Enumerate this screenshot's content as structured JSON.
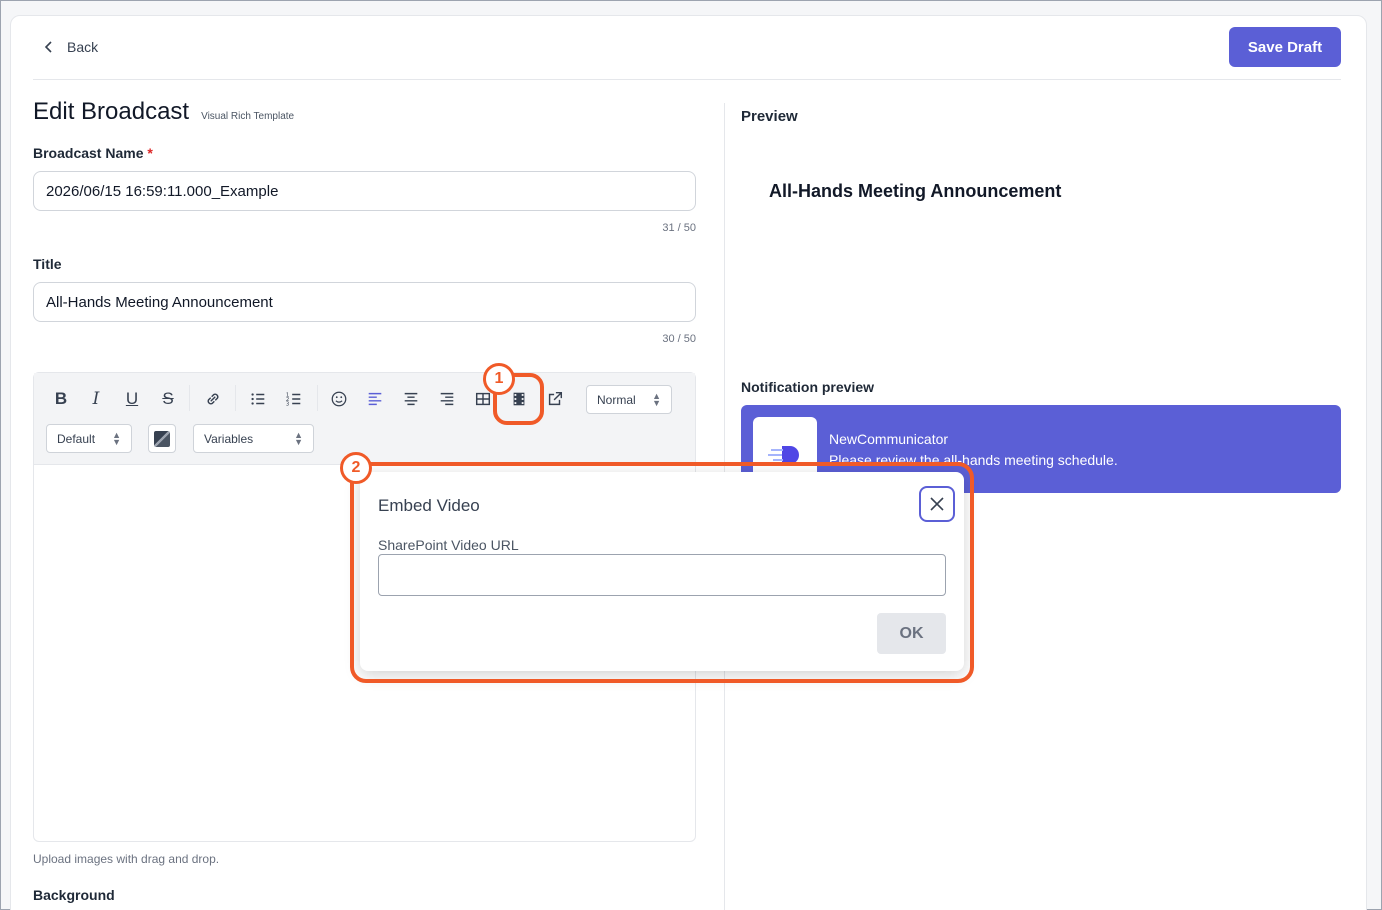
{
  "header": {
    "back_label": "Back",
    "save_label": "Save Draft"
  },
  "form": {
    "page_title": "Edit Broadcast",
    "template_name": "Visual Rich Template",
    "broadcast_name_label": "Broadcast Name",
    "required_marker": "*",
    "broadcast_name_value": "2026/06/15 16:59:11.000_Example",
    "broadcast_name_counter": "31 / 50",
    "title_label": "Title",
    "title_value": "All-Hands Meeting Announcement",
    "title_counter": "30 / 50",
    "upload_hint": "Upload images with drag and drop.",
    "background_label": "Background"
  },
  "toolbar": {
    "heading_select": "Normal",
    "font_select": "Default",
    "variables_select": "Variables",
    "bold": "B",
    "italic": "I",
    "underline": "U",
    "strike": "S"
  },
  "preview": {
    "label": "Preview",
    "title": "All-Hands Meeting Announcement",
    "notification_label": "Notification preview",
    "app_name": "NewCommunicator",
    "message": "Please review the all-hands meeting schedule."
  },
  "modal": {
    "title": "Embed Video",
    "field_label": "SharePoint Video URL",
    "field_value": "",
    "ok_label": "OK"
  },
  "callouts": {
    "one": "1",
    "two": "2"
  },
  "colors": {
    "accent": "#5b5fd6",
    "callout": "#f05a28",
    "active_align": "#5b5fd6"
  }
}
